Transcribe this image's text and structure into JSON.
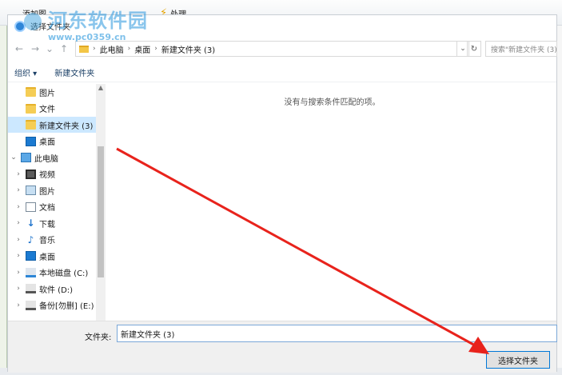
{
  "bg_app": {
    "toolbar_items": [
      "添加图",
      "处理"
    ],
    "side_strip_color": "#eef3e9"
  },
  "watermark": {
    "text": "河东软件园",
    "url": "www.pc0359.cn"
  },
  "dialog": {
    "title": "选择文件夹",
    "address": {
      "crumbs": [
        "此电脑",
        "桌面",
        "新建文件夹 (3)"
      ]
    },
    "search_placeholder": "搜索\"新建文件夹 (3)\"",
    "commands": {
      "organize": "组织 ▾",
      "new_folder": "新建文件夹"
    },
    "nav_items": [
      {
        "label": "图片",
        "icon": "folder-icon",
        "indent": 2,
        "chevron": ""
      },
      {
        "label": "文件",
        "icon": "folder-icon",
        "indent": 2,
        "chevron": ""
      },
      {
        "label": "新建文件夹 (3)",
        "icon": "folder-icon",
        "indent": 2,
        "chevron": "",
        "selected": true
      },
      {
        "label": "桌面",
        "icon": "desktop-icon",
        "indent": 2,
        "chevron": ""
      },
      {
        "label": "此电脑",
        "icon": "pc-icon",
        "indent": 1,
        "chevron": "⌄"
      },
      {
        "label": "视频",
        "icon": "video-icon",
        "indent": 2,
        "chevron": "›"
      },
      {
        "label": "图片",
        "icon": "picture-icon",
        "indent": 2,
        "chevron": "›"
      },
      {
        "label": "文档",
        "icon": "document-icon",
        "indent": 2,
        "chevron": "›"
      },
      {
        "label": "下载",
        "icon": "download-icon",
        "indent": 2,
        "chevron": "›"
      },
      {
        "label": "音乐",
        "icon": "music-icon",
        "indent": 2,
        "chevron": "›"
      },
      {
        "label": "桌面",
        "icon": "desktop-icon",
        "indent": 2,
        "chevron": "›"
      },
      {
        "label": "本地磁盘 (C:)",
        "icon": "drive-c-icon",
        "indent": 2,
        "chevron": "›"
      },
      {
        "label": "软件 (D:)",
        "icon": "drive-icon",
        "indent": 2,
        "chevron": "›"
      },
      {
        "label": "备份[勿删] (E:)",
        "icon": "drive-icon",
        "indent": 2,
        "chevron": "›"
      }
    ],
    "empty_message": "没有与搜索条件匹配的项。",
    "folder_label": "文件夹:",
    "folder_value": "新建文件夹 (3)",
    "select_button": "选择文件夹"
  },
  "annotation": {
    "arrow_color": "#e8231c"
  }
}
